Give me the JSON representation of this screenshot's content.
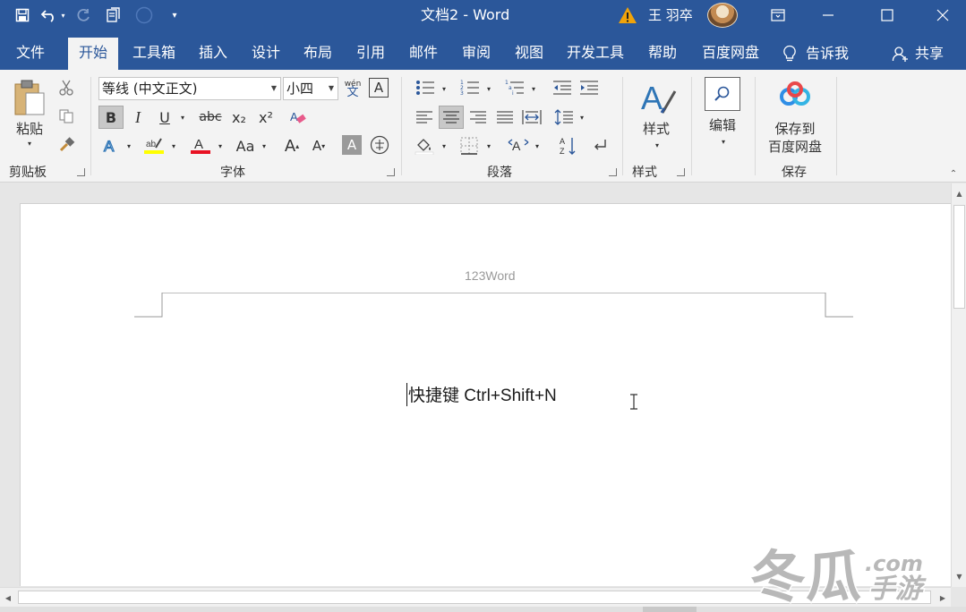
{
  "titlebar": {
    "doc_title": "文档2  -  Word",
    "user_name": "王 羽卒"
  },
  "tabs": [
    {
      "label": "文件"
    },
    {
      "label": "开始"
    },
    {
      "label": "工具箱"
    },
    {
      "label": "插入"
    },
    {
      "label": "设计"
    },
    {
      "label": "布局"
    },
    {
      "label": "引用"
    },
    {
      "label": "邮件"
    },
    {
      "label": "审阅"
    },
    {
      "label": "视图"
    },
    {
      "label": "开发工具"
    },
    {
      "label": "帮助"
    },
    {
      "label": "百度网盘"
    }
  ],
  "active_tab": "开始",
  "tell_me": "告诉我",
  "share": "共享",
  "ribbon": {
    "clipboard": {
      "paste_label": "粘贴",
      "group_label": "剪贴板"
    },
    "font": {
      "font_name": "等线 (中文正文)",
      "font_size": "小四",
      "bold": "B",
      "italic": "I",
      "underline": "U",
      "strike": "abc",
      "subscript": "x₂",
      "superscript": "x²",
      "change_case": "Aa",
      "grow": "A",
      "shrink": "A",
      "phonetic": "wén",
      "phonetic_sub": "文",
      "border_char": "A",
      "shade_char": "A",
      "enclose_char": "字",
      "group_label": "字体",
      "highlight_color": "#ffff00",
      "font_color": "#e81123"
    },
    "paragraph": {
      "group_label": "段落"
    },
    "styles": {
      "label": "样式",
      "group_label": "样式"
    },
    "editing": {
      "label": "编辑"
    },
    "save": {
      "label_line1": "保存到",
      "label_line2": "百度网盘",
      "group_label": "保存"
    }
  },
  "document": {
    "header_text": "123Word",
    "body_text": "快捷键 Ctrl+Shift+N"
  },
  "colors": {
    "brand": "#2b579a",
    "ribbon_bg": "#f3f3f3",
    "warning": "#f0a30a"
  }
}
